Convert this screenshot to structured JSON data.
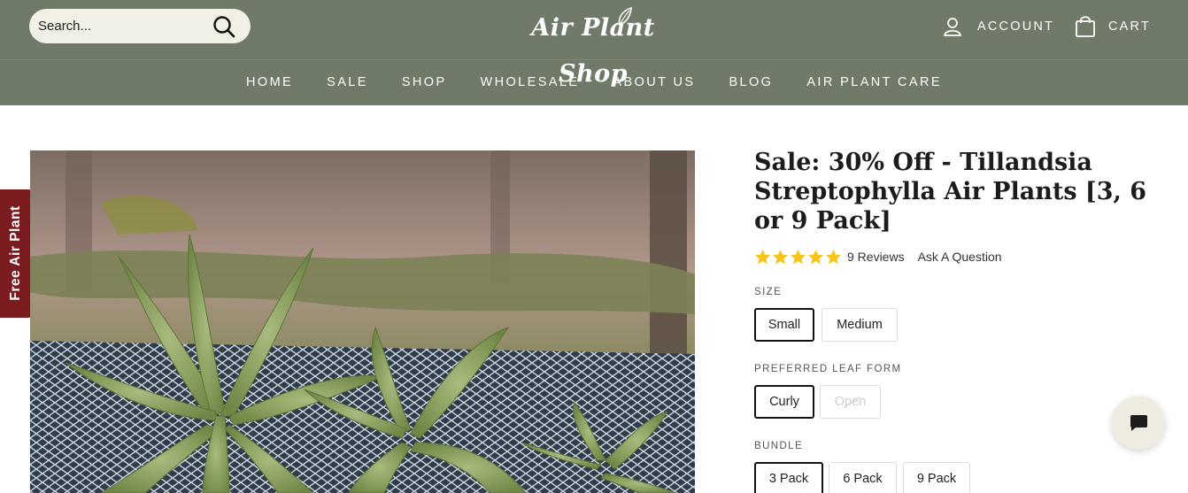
{
  "header": {
    "search": {
      "placeholder": "Search..."
    },
    "logo_text": "Air Plant Shop",
    "account_label": "ACCOUNT",
    "cart_label": "CART",
    "icons": {
      "search": "search-icon",
      "account": "user-icon",
      "cart": "shopping-bag-icon",
      "logo": "leaf-icon"
    },
    "colors": {
      "header_bg": "#6f7a68",
      "text": "#ffffff"
    }
  },
  "nav": {
    "items": [
      {
        "label": "HOME"
      },
      {
        "label": "SALE"
      },
      {
        "label": "SHOP"
      },
      {
        "label": "WHOLESALE"
      },
      {
        "label": "ABOUT US"
      },
      {
        "label": "BLOG"
      },
      {
        "label": "AIR PLANT CARE"
      }
    ]
  },
  "side_tab": {
    "label": "Free Air Plant",
    "color": "#7a1c1f"
  },
  "product": {
    "title": "Sale: 30% Off - Tillandsia Streptophylla Air Plants [3, 6 or 9 Pack]",
    "rating": {
      "stars": 5,
      "max": 5,
      "reviews_label": "9 Reviews",
      "star_color": "#f5c518"
    },
    "ask_question_label": "Ask A Question",
    "options": {
      "size": {
        "label": "SIZE",
        "values": [
          {
            "label": "Small",
            "selected": true
          },
          {
            "label": "Medium",
            "selected": false
          }
        ]
      },
      "leaf_form": {
        "label": "PREFERRED LEAF FORM",
        "values": [
          {
            "label": "Curly",
            "selected": true
          },
          {
            "label": "Open",
            "selected": false,
            "disabled": true
          }
        ]
      },
      "bundle": {
        "label": "BUNDLE",
        "values": [
          {
            "label": "3 Pack",
            "selected": true
          },
          {
            "label": "6 Pack",
            "selected": false
          },
          {
            "label": "9 Pack",
            "selected": false
          }
        ]
      }
    }
  },
  "chat": {
    "icon": "chat-bubble-icon"
  }
}
